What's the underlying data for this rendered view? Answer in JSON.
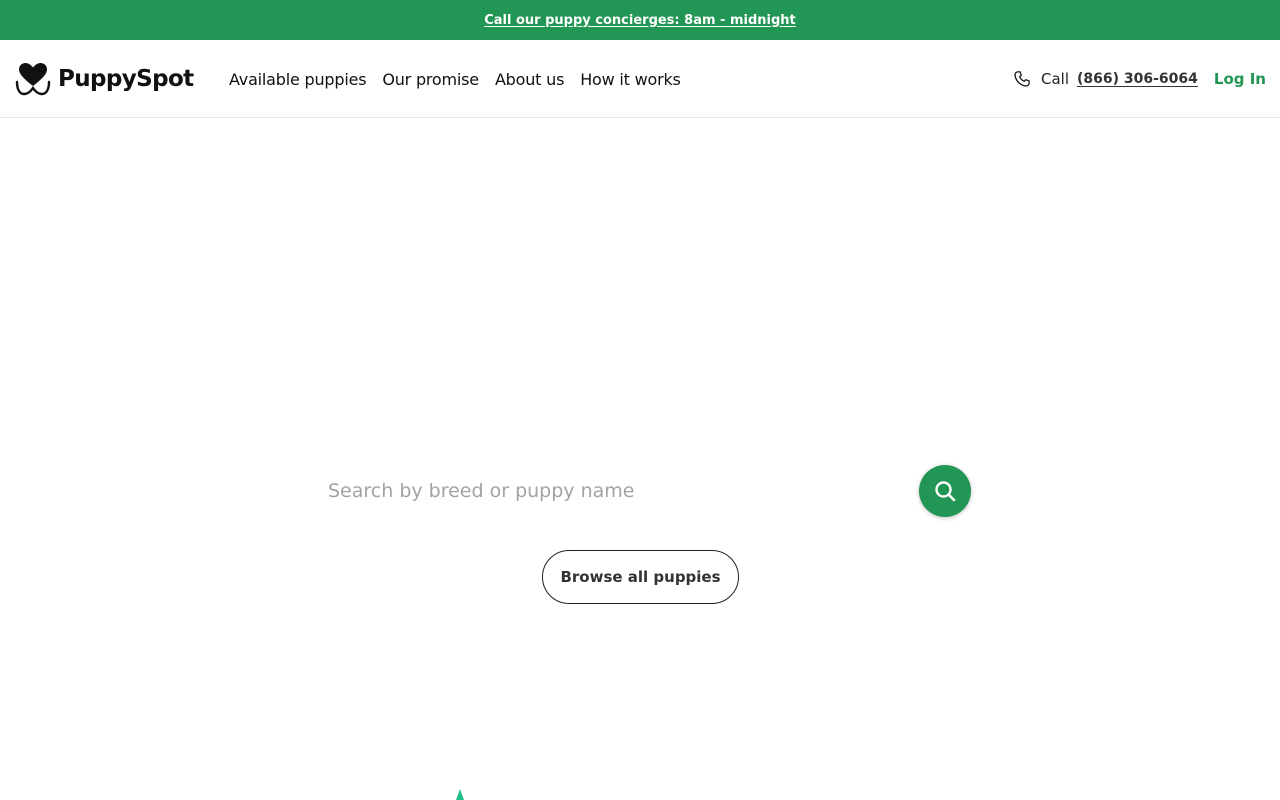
{
  "promo_bar": {
    "text": "Call our puppy concierges: 8am - midnight",
    "background": "#229654"
  },
  "header": {
    "logo": {
      "text": "PuppySpot",
      "icon": "heart-paw-logo"
    },
    "nav": [
      {
        "label": "Available puppies"
      },
      {
        "label": "Our promise"
      },
      {
        "label": "About us"
      },
      {
        "label": "How it works"
      }
    ],
    "contact": {
      "icon": "phone-icon",
      "call_label": "Call",
      "phone": "(866) 306-6064"
    },
    "login_label": "Log In"
  },
  "search": {
    "placeholder": "Search by breed or puppy name",
    "value": "",
    "button_icon": "search-icon"
  },
  "browse": {
    "label": "Browse all puppies"
  },
  "colors": {
    "accent": "#229654",
    "text": "#111111"
  }
}
